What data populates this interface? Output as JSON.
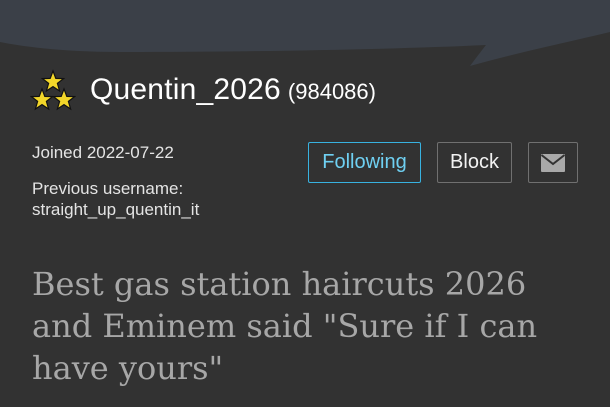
{
  "profile": {
    "username": "Quentin_2026",
    "user_id": "(984086)",
    "rank_icon": "three-stars-icon",
    "joined": "Joined 2022-07-22",
    "previous_username_label": "Previous username:",
    "previous_username": "straight_up_quentin_it"
  },
  "actions": {
    "following_label": "Following",
    "block_label": "Block",
    "message_icon": "mail-icon"
  },
  "bio": {
    "text": "Best gas station haircuts 2026 and Eminem said \"Sure if I can have yours\""
  },
  "colors": {
    "background": "#323232",
    "header_shape": "#3b4048",
    "accent": "#38b2e0",
    "bio_text": "#a7a7a7",
    "star": "#f2d62a"
  }
}
